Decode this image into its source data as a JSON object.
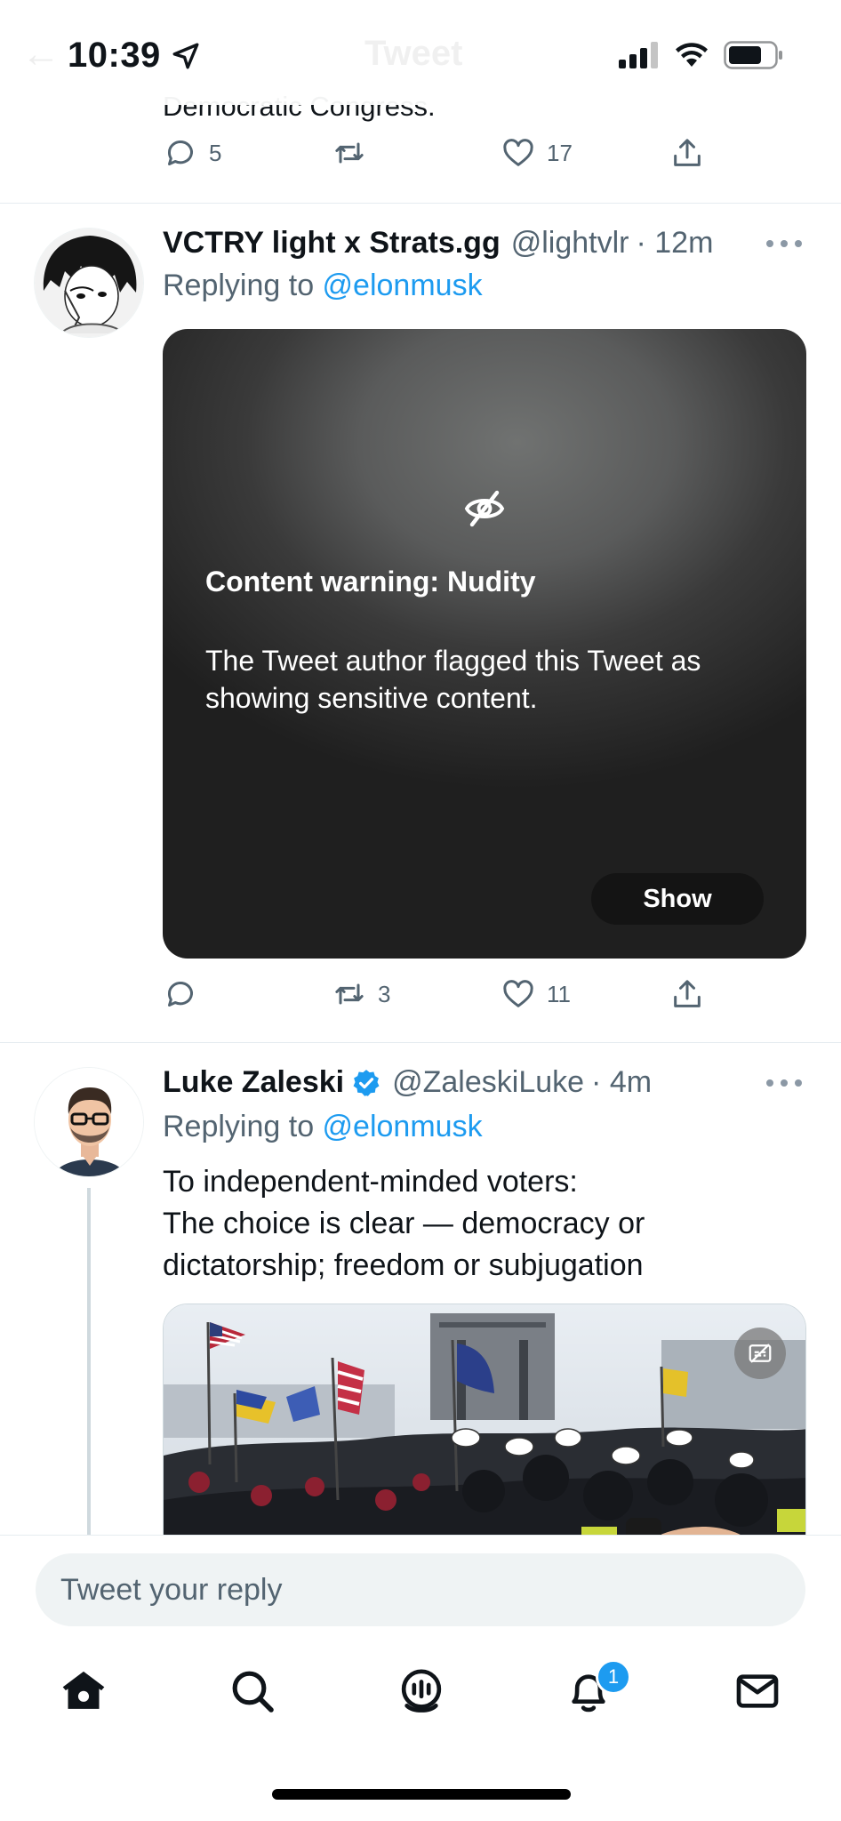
{
  "status_bar": {
    "time": "10:39"
  },
  "header": {
    "back_label": "←",
    "title": "Tweet"
  },
  "previous_tweet": {
    "text_fragment": "Democratic Congress.",
    "replies": "5",
    "retweets": "",
    "likes": "17"
  },
  "tweet1": {
    "name": "VCTRY light x Strats.gg",
    "handle": "@lightvlr",
    "time": "· 12m",
    "replying_prefix": "Replying to ",
    "replying_to": "@elonmusk",
    "content_warning": {
      "title": "Content warning: Nudity",
      "body": "The Tweet author flagged this Tweet as showing sensitive content.",
      "show_label": "Show"
    },
    "replies": "",
    "retweets": "3",
    "likes": "11"
  },
  "tweet2": {
    "name": "Luke Zaleski",
    "handle": "@ZaleskiLuke",
    "time": "· 4m",
    "replying_prefix": "Replying to ",
    "replying_to": "@elonmusk",
    "text_lines": [
      "To independent-minded voters:",
      "The choice is clear — democracy or",
      "dictatorship; freedom or subjugation"
    ]
  },
  "reply_bar": {
    "placeholder": "Tweet your reply"
  },
  "tabbar": {
    "notifications_badge": "1",
    "items": [
      "home-icon",
      "search-icon",
      "spaces-icon",
      "notifications-icon",
      "messages-icon"
    ]
  },
  "colors": {
    "accent": "#1d9bf0",
    "text": "#0f1419",
    "secondary": "#536471"
  }
}
